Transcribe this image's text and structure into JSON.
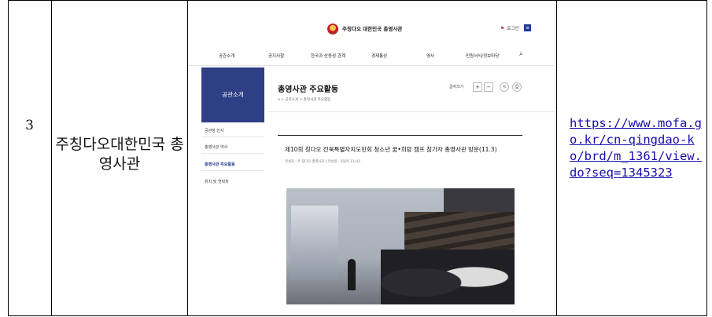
{
  "row": {
    "number": "3",
    "organization": "주칭다오대한민국 총영사관",
    "link": "https://www.mofa.go.kr/cn-qingdao-ko/brd/m_1361/view.do?seq=1345323"
  },
  "screenshot": {
    "site_name": "주칭다오 대한민국 총영사관",
    "login_label": "로그인",
    "menu_badge": "≡",
    "nav": [
      "공관소개",
      "공지사항",
      "한국과 산동성 관계",
      "경제통상",
      "영사",
      "민원서식/정보마당"
    ],
    "sidebar": {
      "banner": "공관소개",
      "items": [
        "공관장 인사",
        "총영사관 약사",
        "총영사관 주요활동",
        "위치 및 연락처"
      ],
      "active_index": 2
    },
    "page_title": "총영사관 주요활동",
    "breadcrumb": "⌂ > 공관소개 > 총영사관 주요활동",
    "font_size_label": "글자크기",
    "post_title": "제10회 칭다오 전북특별자치도민회 청소년 꿈•희망 캠프 참가자 총영사관 방문(11.3)",
    "post_meta": "작성자 : 주 칭다오 총영사관  |  작성일 : 2025-11-03."
  },
  "colors": {
    "banner_bg": "#2e3f86",
    "link": "#1a0dab"
  }
}
